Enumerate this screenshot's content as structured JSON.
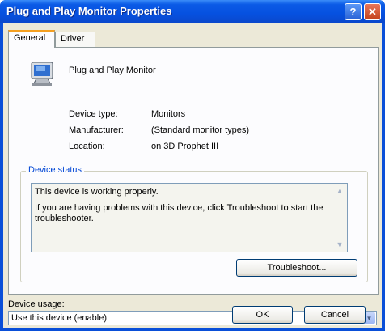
{
  "window": {
    "title": "Plug and Play Monitor Properties",
    "help_glyph": "?",
    "close_glyph": "✕"
  },
  "tabs": [
    {
      "label": "General",
      "active": true
    },
    {
      "label": "Driver",
      "active": false
    }
  ],
  "device": {
    "name": "Plug and Play Monitor",
    "icon": "monitor-icon",
    "properties": [
      {
        "label": "Device type:",
        "value": "Monitors"
      },
      {
        "label": "Manufacturer:",
        "value": "(Standard monitor types)"
      },
      {
        "label": "Location:",
        "value": "on 3D Prophet III"
      }
    ]
  },
  "status": {
    "group_title": "Device status",
    "line1": "This device is working properly.",
    "line2": "If you are having problems with this device, click Troubleshoot to start the troubleshooter.",
    "troubleshoot_label": "Troubleshoot..."
  },
  "usage": {
    "label": "Device usage:",
    "selected": "Use this device (enable)"
  },
  "footer": {
    "ok_label": "OK",
    "cancel_label": "Cancel"
  },
  "colors": {
    "title_bar": "#0651e0",
    "group_title": "#0046d5",
    "dialog_face": "#ece9d8"
  }
}
